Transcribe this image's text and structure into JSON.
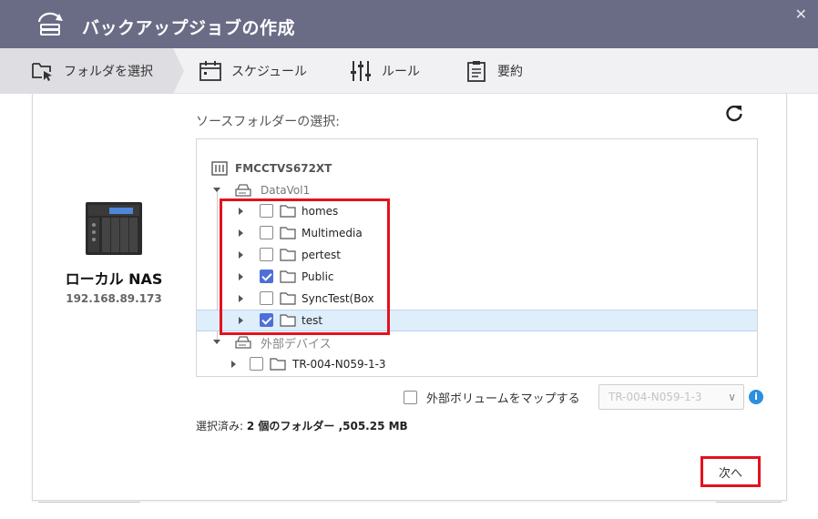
{
  "window": {
    "title": "バックアップジョブの作成",
    "close_glyph": "✕"
  },
  "steps": [
    {
      "label": "フォルダを選択",
      "icon": "folder-select-icon",
      "active": true
    },
    {
      "label": "スケジュール",
      "icon": "calendar-icon",
      "active": false
    },
    {
      "label": "ルール",
      "icon": "sliders-icon",
      "active": false
    },
    {
      "label": "要約",
      "icon": "clipboard-icon",
      "active": false
    }
  ],
  "nas": {
    "name": "ローカル NAS",
    "ip": "192.168.89.173"
  },
  "source": {
    "label": "ソースフォルダーの選択:",
    "refresh_icon": "refresh-icon"
  },
  "tree": {
    "root": "FMCCTVS672XT",
    "volume": "DataVol1",
    "folders": [
      {
        "name": "homes",
        "checked": false
      },
      {
        "name": "Multimedia",
        "checked": false
      },
      {
        "name": "pertest",
        "checked": false
      },
      {
        "name": "Public",
        "checked": true
      },
      {
        "name": "SyncTest(Box",
        "checked": false
      },
      {
        "name": "test",
        "checked": true,
        "selected": true
      }
    ],
    "external_label": "外部デバイス",
    "external_items": [
      {
        "name": "TR-004-N059-1-3",
        "checked": false
      }
    ]
  },
  "map_external": {
    "label": "外部ボリュームをマップする",
    "checked": false,
    "select_value": "TR-004-N059-1-3",
    "chevron": "∨",
    "info_glyph": "i"
  },
  "summary": {
    "prefix": "選択済み: ",
    "text": "2 個のフォルダー ,505.25 MB"
  },
  "next_label": "次へ",
  "colors": {
    "titlebar": "#6a6c86",
    "checkbox_checked": "#4f6fd8",
    "selected_row": "#dfeefb",
    "highlight": "#e3121e",
    "info": "#2e8ee0"
  }
}
